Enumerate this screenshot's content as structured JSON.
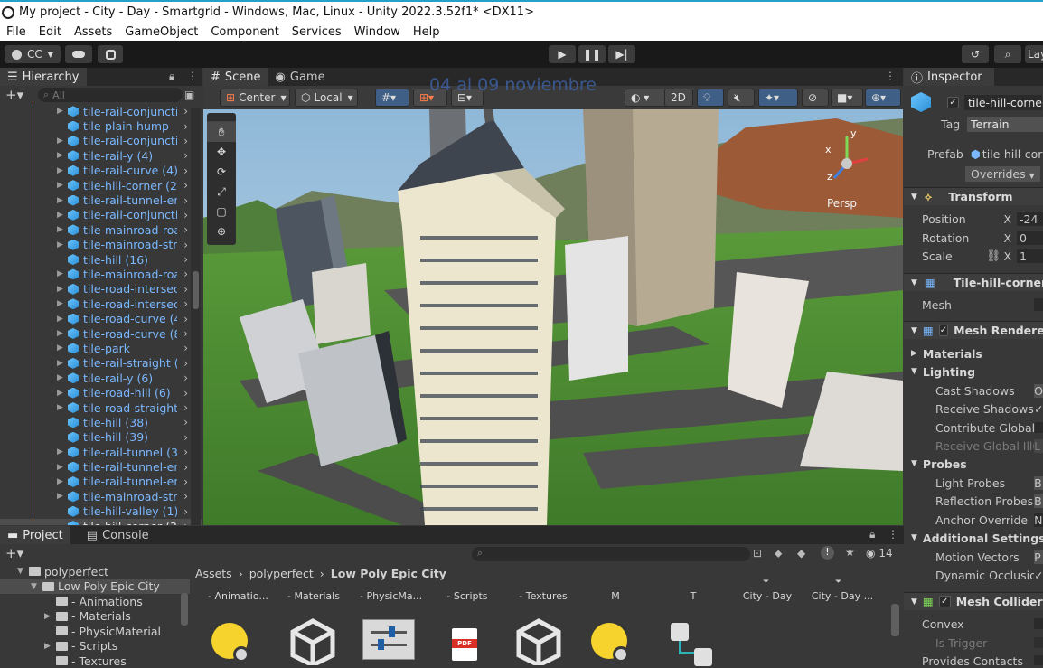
{
  "window": {
    "title": "My project - City - Day - Smartgrid - Windows, Mac, Linux - Unity 2022.3.52f1* <DX11>"
  },
  "menu": [
    "File",
    "Edit",
    "Assets",
    "GameObject",
    "Component",
    "Services",
    "Window",
    "Help"
  ],
  "toolbar": {
    "account": "CC",
    "layout": "Lay"
  },
  "hierarchy": {
    "tab": "Hierarchy",
    "search_placeholder": "All",
    "items": [
      {
        "label": "tile-rail-conjuncti",
        "expand": true
      },
      {
        "label": "tile-plain-hump",
        "expand": false
      },
      {
        "label": "tile-rail-conjuncti",
        "expand": true
      },
      {
        "label": "tile-rail-y (4)",
        "expand": true
      },
      {
        "label": "tile-rail-curve (4)",
        "expand": true
      },
      {
        "label": "tile-hill-corner (2)",
        "expand": true
      },
      {
        "label": "tile-rail-tunnel-er",
        "expand": true
      },
      {
        "label": "tile-rail-conjuncti",
        "expand": true
      },
      {
        "label": "tile-mainroad-roa",
        "expand": true
      },
      {
        "label": "tile-mainroad-stra",
        "expand": true
      },
      {
        "label": "tile-hill (16)",
        "expand": false
      },
      {
        "label": "tile-mainroad-roa",
        "expand": true
      },
      {
        "label": "tile-road-intersec",
        "expand": true
      },
      {
        "label": "tile-road-intersec",
        "expand": true
      },
      {
        "label": "tile-road-curve (4",
        "expand": true
      },
      {
        "label": "tile-road-curve (8",
        "expand": true
      },
      {
        "label": "tile-park",
        "expand": true
      },
      {
        "label": "tile-rail-straight (",
        "expand": true
      },
      {
        "label": "tile-rail-y (6)",
        "expand": true
      },
      {
        "label": "tile-road-hill (6)",
        "expand": true
      },
      {
        "label": "tile-road-straight",
        "expand": true
      },
      {
        "label": "tile-hill (38)",
        "expand": false
      },
      {
        "label": "tile-hill (39)",
        "expand": false
      },
      {
        "label": "tile-rail-tunnel (3",
        "expand": true
      },
      {
        "label": "tile-rail-tunnel-er",
        "expand": true
      },
      {
        "label": "tile-rail-tunnel-er",
        "expand": true
      },
      {
        "label": "tile-mainroad-stra",
        "expand": true
      },
      {
        "label": "tile-hill-valley (1)",
        "expand": false
      },
      {
        "label": "tile-hill-corner (3",
        "expand": false,
        "selected": true
      }
    ]
  },
  "scene": {
    "tabs": [
      "Scene",
      "Game"
    ],
    "pivot": "Center",
    "space": "Local",
    "mode_2d": "2D",
    "overlay_text": "04 al 09 noviembre",
    "gizmo_label": "Persp",
    "gizmo_axes": [
      "x",
      "y",
      "z"
    ]
  },
  "inspector": {
    "tab": "Inspector",
    "object_name": "tile-hill-corne",
    "tag_label": "Tag",
    "tag_value": "Terrain",
    "prefab_label": "Prefab",
    "prefab_value": "tile-hill-corn",
    "overrides": "Overrides",
    "transform": {
      "title": "Transform",
      "rows": [
        {
          "label": "Position",
          "axis": "X",
          "value": "-24"
        },
        {
          "label": "Rotation",
          "axis": "X",
          "value": "0"
        },
        {
          "label": "Scale",
          "axis": "X",
          "value": "1"
        }
      ]
    },
    "mesh_filter": {
      "title": "Tile-hill-corner",
      "field": "Mesh"
    },
    "mesh_renderer": {
      "title": "Mesh Renderer",
      "materials": "Materials",
      "lighting": "Lighting",
      "lighting_rows": [
        {
          "label": "Cast Shadows",
          "value": "O"
        },
        {
          "label": "Receive Shadows",
          "value": "✓"
        },
        {
          "label": "Contribute Global I",
          "value": ""
        },
        {
          "label": "Receive Global Illu",
          "value": "L"
        }
      ],
      "probes": "Probes",
      "probe_rows": [
        {
          "label": "Light Probes",
          "value": "B"
        },
        {
          "label": "Reflection Probes",
          "value": "B"
        },
        {
          "label": "Anchor Override",
          "value": "N"
        }
      ],
      "additional": "Additional Settings",
      "additional_rows": [
        {
          "label": "Motion Vectors",
          "value": "P"
        },
        {
          "label": "Dynamic Occlusion",
          "value": "✓"
        }
      ]
    },
    "mesh_collider": {
      "title": "Mesh Collider",
      "rows": [
        "Convex",
        "Is Trigger",
        "Provides Contacts"
      ]
    }
  },
  "project": {
    "tabs": [
      "Project",
      "Console"
    ],
    "tree": [
      {
        "label": "polyperfect",
        "indent": 1,
        "arrow": "▼"
      },
      {
        "label": "Low Poly Epic City",
        "indent": 2,
        "arrow": "▼",
        "selected": true
      },
      {
        "label": "- Animations",
        "indent": 3,
        "arrow": ""
      },
      {
        "label": "- Materials",
        "indent": 3,
        "arrow": "▶"
      },
      {
        "label": "- PhysicMaterial",
        "indent": 3,
        "arrow": ""
      },
      {
        "label": "- Scripts",
        "indent": 3,
        "arrow": "▶"
      },
      {
        "label": "- Textures",
        "indent": 3,
        "arrow": ""
      }
    ],
    "breadcrumb": [
      "Assets",
      "polyperfect",
      "Low Poly Epic City"
    ],
    "hidden_count": "14",
    "assets": [
      "- Animatio...",
      "- Materials",
      "- PhysicMa...",
      "- Scripts",
      "- Textures",
      "M",
      "T",
      "City - Day",
      "City - Day ..."
    ]
  }
}
